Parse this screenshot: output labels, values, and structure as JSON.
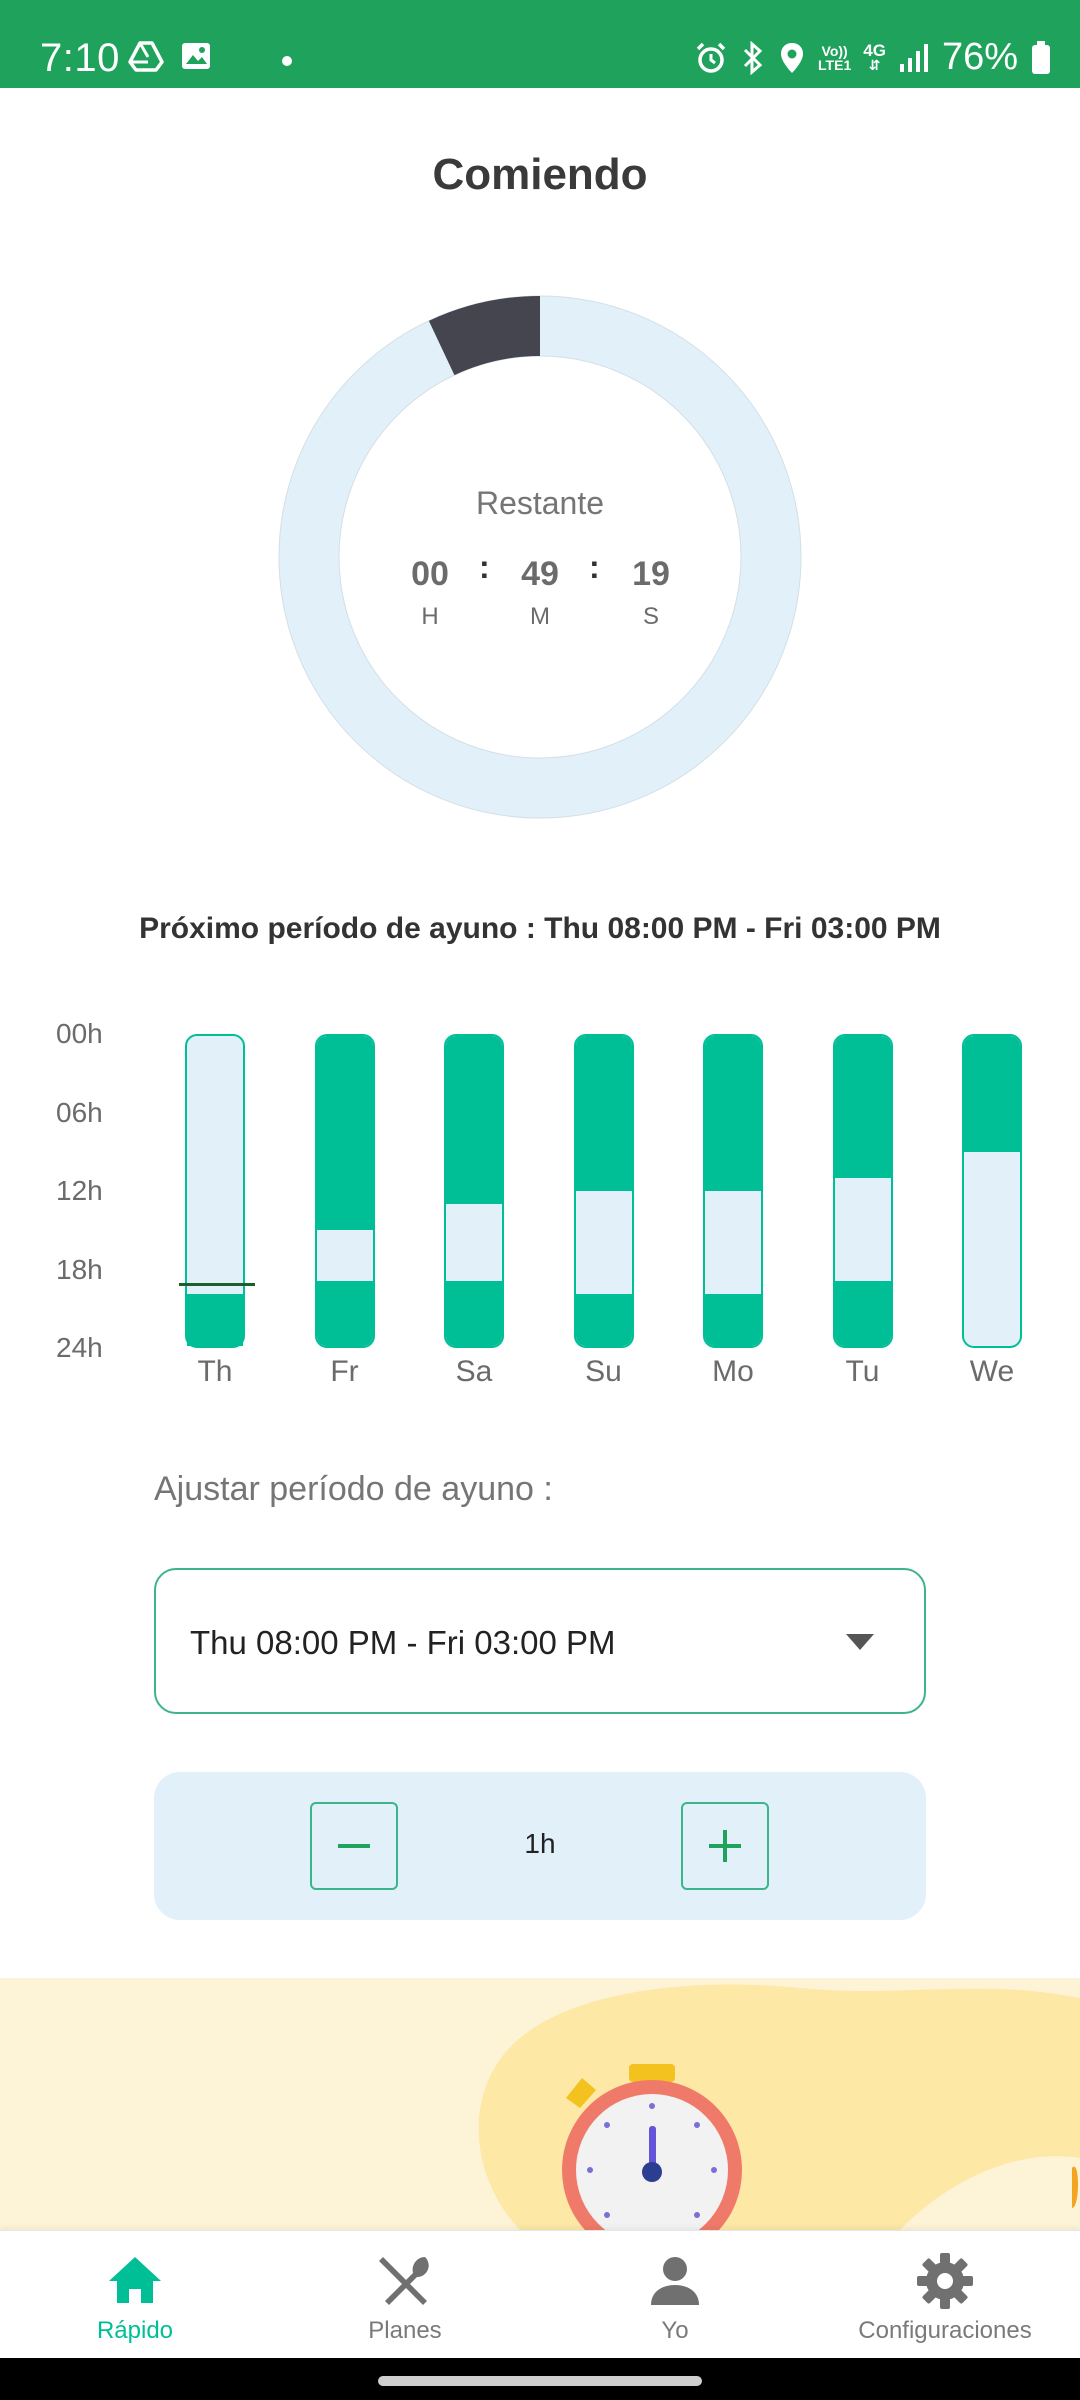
{
  "status_bar": {
    "time": "7:10",
    "battery": "76%",
    "network_top": "Vo))",
    "network_bottom": "LTE1",
    "network_type": "4G",
    "icons": [
      "drive-icon",
      "gallery-icon",
      "alarm-icon",
      "bluetooth-icon",
      "location-icon",
      "signal-icon",
      "battery-icon"
    ]
  },
  "header": {
    "title": "Comiendo"
  },
  "timer": {
    "label": "Restante",
    "hours": "00",
    "minutes": "49",
    "seconds": "19",
    "h_label": "H",
    "m_label": "M",
    "s_label": "S",
    "separator": ":",
    "progress_fraction": 0.07
  },
  "next_fast": {
    "text": "Próximo período de ayuno  : Thu 08:00 PM - Fri 03:00 PM"
  },
  "chart_data": {
    "type": "bar",
    "y_ticks": [
      "00h",
      "06h",
      "12h",
      "18h",
      "24h"
    ],
    "ylim": [
      0,
      24
    ],
    "categories": [
      "Th",
      "Fr",
      "Sa",
      "Su",
      "Mo",
      "Tu",
      "We"
    ],
    "series": [
      {
        "values": [
          [
            [
              20,
              24
            ]
          ],
          [
            [
              0,
              15
            ],
            [
              19,
              24
            ]
          ],
          [
            [
              0,
              13
            ],
            [
              19,
              24
            ]
          ],
          [
            [
              0,
              12
            ],
            [
              20,
              24
            ]
          ],
          [
            [
              0,
              12
            ],
            [
              20,
              24
            ]
          ],
          [
            [
              0,
              11
            ],
            [
              19,
              24
            ]
          ],
          [
            [
              0,
              9
            ]
          ]
        ]
      }
    ],
    "current_time_marker": {
      "day": "Th",
      "hour": 19
    }
  },
  "adjust": {
    "label": "Ajustar período de ayuno :",
    "selected": "Thu 08:00 PM - Fri 03:00 PM",
    "step_value": "1h"
  },
  "bottom_nav": {
    "items": [
      {
        "label": "Rápido",
        "icon": "home-icon",
        "active": true
      },
      {
        "label": "Planes",
        "icon": "fork-knife-icon",
        "active": false
      },
      {
        "label": "Yo",
        "icon": "person-icon",
        "active": false
      },
      {
        "label": "Configuraciones",
        "icon": "gear-icon",
        "active": false
      }
    ]
  },
  "colors": {
    "status_bar": "#1fa35c",
    "accent": "#00bf96",
    "light_blue": "#e2f0fa",
    "ring_progress": "#44454f"
  }
}
